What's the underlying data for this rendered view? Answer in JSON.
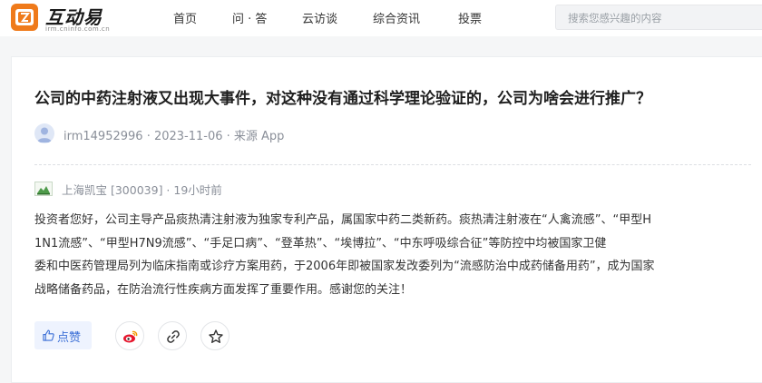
{
  "site": {
    "logo_text": "互动易",
    "logo_sub": "irm.cninfo.com.cn"
  },
  "nav": {
    "items": [
      {
        "label": "首页"
      },
      {
        "label": "问 · 答"
      },
      {
        "label": "云访谈"
      },
      {
        "label": "综合资讯"
      },
      {
        "label": "投票"
      }
    ]
  },
  "search": {
    "placeholder": "搜索您感兴趣的内容"
  },
  "question": {
    "title": "公司的中药注射液又出现大事件，对这种没有通过科学理论验证的，公司为啥会进行推广？",
    "asker_meta": "irm14952996 · 2023-11-06 · 来源 App"
  },
  "answer": {
    "meta": "上海凯宝 [300039] · 19小时前",
    "lines": [
      "投资者您好，公司主导产品痰热清注射液为独家专利产品，属国家中药二类新药。痰热清注射液在“人禽流感”、“甲型H",
      "1N1流感”、“甲型H7N9流感”、“手足口病”、“登革热”、“埃博拉”、“中东呼吸综合征”等防控中均被国家卫健",
      "委和中医药管理局列为临床指南或诊疗方案用药，于2006年即被国家发改委列为“流感防治中成药储备用药”，成为国家",
      "战略储备药品，在防治流行性疾病方面发挥了重要作用。感谢您的关注！"
    ]
  },
  "actions": {
    "like_label": "点赞",
    "icons": [
      "thumbs-up-icon",
      "weibo-icon",
      "link-icon",
      "star-icon"
    ]
  },
  "colors": {
    "brand": "#ef7a1a",
    "link": "#3b6fd6",
    "weibo": "#e6162d"
  }
}
